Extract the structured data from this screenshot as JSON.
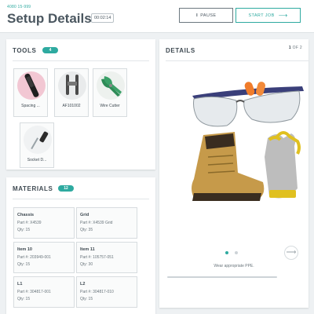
{
  "header": {
    "job_number": "4080 15-999",
    "title": "Setup Details",
    "timer": "00:02:14",
    "pause_label": "PAUSE",
    "start_label": "START JOB"
  },
  "tools": {
    "title": "TOOLS",
    "count": "4",
    "items": [
      {
        "label": "Spacing ..."
      },
      {
        "label": "AF101002"
      },
      {
        "label": "Wire Cutter"
      },
      {
        "label": "Socket D..."
      }
    ]
  },
  "materials": {
    "title": "MATERIALS",
    "count": "12",
    "items": [
      {
        "name": "Chassis",
        "part": "Part #: X4539",
        "qty": "Qty: 15"
      },
      {
        "name": "Grid",
        "part": "Part #: X4539 Grid",
        "qty": "Qty: 35"
      },
      {
        "name": "Item 10",
        "part": "Part #: 203949-001",
        "qty": "Qty: 15"
      },
      {
        "name": "Item 11",
        "part": "Part #: 105757-051",
        "qty": "Qty: 30"
      },
      {
        "name": "L1",
        "part": "Part #: 304817-001",
        "qty": "Qty: 15"
      },
      {
        "name": "L2",
        "part": "Part #: 304817-010",
        "qty": "Qty: 15"
      }
    ]
  },
  "details": {
    "title": "DETAILS",
    "page_current": "1",
    "page_separator": "OF",
    "page_total": "2",
    "caption": "Wear appropriate PPE."
  },
  "colors": {
    "accent": "#2eaaa0",
    "text": "#3f4a52"
  },
  "icons": {
    "pause": "pause-icon",
    "start_arrow": "arrow-right-icon",
    "next": "arrow-right-icon"
  }
}
